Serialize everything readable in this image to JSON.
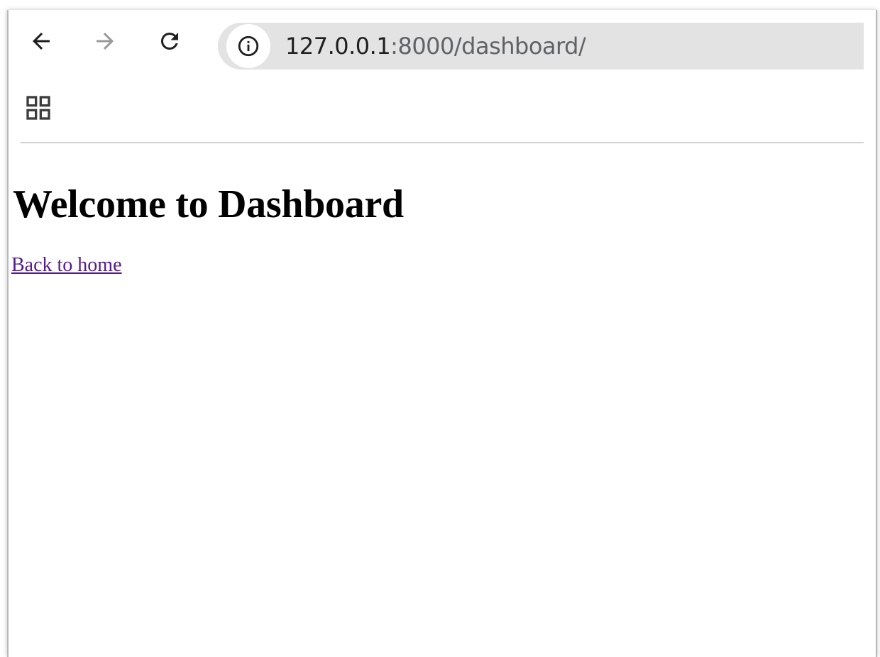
{
  "browser": {
    "address_bar": {
      "host": "127.0.0.1",
      "path": ":8000/dashboard/"
    },
    "icons": {
      "back": "back-arrow-icon",
      "forward": "forward-arrow-icon",
      "reload": "reload-icon",
      "site_info": "info-icon",
      "apps": "apps-grid-icon"
    },
    "forward_enabled": false
  },
  "page": {
    "heading": "Welcome to Dashboard",
    "link_label": "Back to home"
  },
  "colors": {
    "omnibox_bg": "#e3e3e3",
    "link_visited": "#551a8b",
    "heading": "#000000"
  }
}
